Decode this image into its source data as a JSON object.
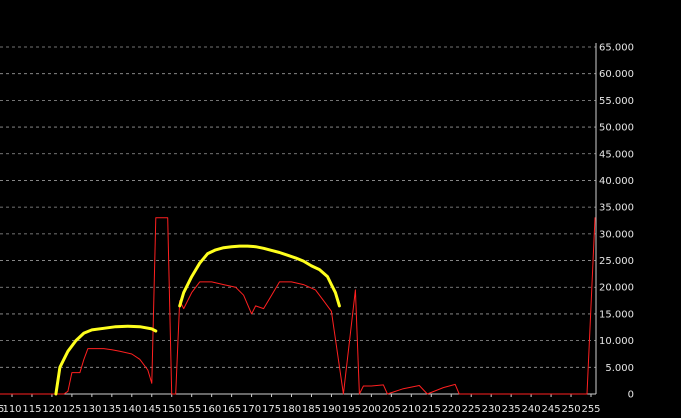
{
  "chart_data": {
    "type": "line",
    "title": "",
    "xlabel": "",
    "ylabel": "",
    "xlim": [
      105,
      257
    ],
    "ylim": [
      0,
      65000
    ],
    "grid": true,
    "x_ticks": [
      110,
      115,
      120,
      125,
      130,
      135,
      140,
      145,
      150,
      155,
      160,
      165,
      170,
      175,
      180,
      185,
      190,
      195,
      200,
      205,
      210,
      215,
      220,
      225,
      230,
      235,
      240,
      245,
      250,
      255
    ],
    "x_tick_labels": [
      "110",
      "115",
      "120",
      "125",
      "130",
      "135",
      "140",
      "145",
      "150",
      "155",
      "160",
      "165",
      "170",
      "175",
      "180",
      "185",
      "190",
      "195",
      "200",
      "205",
      "210",
      "215",
      "220",
      "225",
      "230",
      "235",
      "240",
      "245",
      "250",
      "255"
    ],
    "x_edge_label": "5",
    "y_ticks": [
      0,
      5000,
      10000,
      15000,
      20000,
      25000,
      30000,
      35000,
      40000,
      45000,
      50000,
      55000,
      60000,
      65000
    ],
    "y_tick_labels": [
      "0",
      "5.000",
      "10.000",
      "15.000",
      "20.000",
      "25.000",
      "30.000",
      "35.000",
      "40.000",
      "45.000",
      "50.000",
      "55.000",
      "60.000",
      "65.000"
    ],
    "series": [
      {
        "color": "#ff2020",
        "stroke_width": 1,
        "points": [
          [
            105,
            0
          ],
          [
            122,
            0
          ],
          [
            123,
            0
          ],
          [
            124,
            500
          ],
          [
            125,
            4000
          ],
          [
            126,
            4000
          ],
          [
            127,
            4000
          ],
          [
            128,
            6500
          ],
          [
            129,
            8500
          ],
          [
            131,
            8500
          ],
          [
            133,
            8500
          ],
          [
            135,
            8300
          ],
          [
            137,
            8000
          ],
          [
            140,
            7500
          ],
          [
            142,
            6500
          ],
          [
            144,
            4500
          ],
          [
            145,
            2000
          ],
          [
            146,
            33000
          ],
          [
            149,
            33000
          ],
          [
            150,
            0
          ],
          [
            151,
            0
          ],
          [
            152,
            17500
          ],
          [
            153,
            16000
          ],
          [
            155,
            19000
          ],
          [
            157,
            21000
          ],
          [
            160,
            21000
          ],
          [
            163,
            20500
          ],
          [
            166,
            20000
          ],
          [
            168,
            18500
          ],
          [
            170,
            15000
          ],
          [
            171,
            16500
          ],
          [
            173,
            16000
          ],
          [
            175,
            18500
          ],
          [
            177,
            21000
          ],
          [
            180,
            21000
          ],
          [
            183,
            20500
          ],
          [
            186,
            19500
          ],
          [
            188,
            17500
          ],
          [
            190,
            15500
          ],
          [
            193,
            0
          ],
          [
            196,
            19500
          ],
          [
            197,
            0
          ],
          [
            198,
            1500
          ],
          [
            200,
            1500
          ],
          [
            203,
            1700
          ],
          [
            204,
            0
          ],
          [
            208,
            1000
          ],
          [
            212,
            1600
          ],
          [
            214,
            0
          ],
          [
            218,
            1200
          ],
          [
            221,
            1800
          ],
          [
            222,
            0
          ],
          [
            253,
            0
          ],
          [
            254,
            0
          ],
          [
            256,
            33000
          ]
        ]
      },
      {
        "color": "#ffff1e",
        "stroke_width": 3,
        "points": [
          [
            121,
            0
          ],
          [
            122,
            5000
          ],
          [
            124,
            8000
          ],
          [
            126,
            10000
          ],
          [
            128,
            11400
          ],
          [
            130,
            12000
          ],
          [
            133,
            12300
          ],
          [
            136,
            12600
          ],
          [
            139,
            12700
          ],
          [
            142,
            12600
          ],
          [
            145,
            12200
          ],
          [
            146,
            11800
          ]
        ]
      },
      {
        "color": "#ffff1e",
        "stroke_width": 3,
        "points": [
          [
            152,
            16500
          ],
          [
            153,
            19000
          ],
          [
            155,
            22000
          ],
          [
            157,
            24500
          ],
          [
            159,
            26300
          ],
          [
            161,
            27000
          ],
          [
            163,
            27400
          ],
          [
            165,
            27600
          ],
          [
            167,
            27700
          ],
          [
            169,
            27700
          ],
          [
            171,
            27600
          ],
          [
            173,
            27300
          ],
          [
            175,
            26900
          ],
          [
            177,
            26500
          ],
          [
            179,
            26000
          ],
          [
            181,
            25500
          ],
          [
            183,
            24900
          ],
          [
            185,
            24000
          ],
          [
            187,
            23300
          ],
          [
            189,
            22000
          ],
          [
            190,
            20500
          ],
          [
            191,
            19000
          ],
          [
            192,
            16500
          ]
        ]
      }
    ]
  }
}
